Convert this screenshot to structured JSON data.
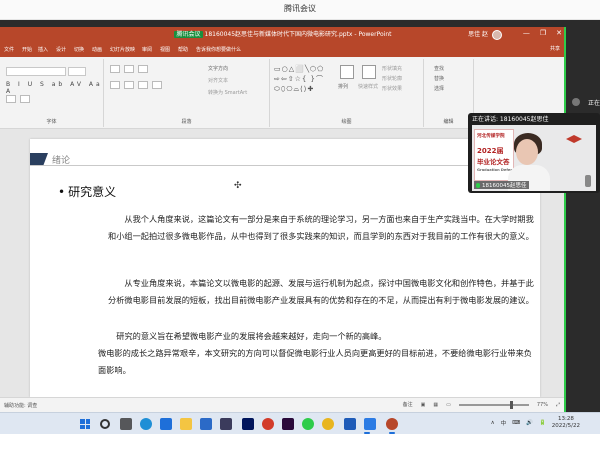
{
  "meeting": {
    "app_title": "腾讯会议"
  },
  "ppt": {
    "window_title": "18160045赵思佳与新媒体时代下国内微电影研究.pptx - PowerPoint",
    "screen_tag": "腾讯会议",
    "user_name": "思佳 赵",
    "window_controls": {
      "minimize": "—",
      "restore": "❐",
      "close": "✕"
    },
    "tabs": [
      "文件",
      "开始",
      "插入",
      "设计",
      "切换",
      "动画",
      "幻灯片放映",
      "审阅",
      "视图",
      "帮助",
      "告诉我你想要做什么"
    ],
    "share_label": "共享",
    "ribbon": {
      "groups": [
        "字体",
        "段落",
        "绘图",
        "编辑"
      ],
      "paragraph_items": [
        "文字方向",
        "对齐文本",
        "转换为 SmartArt"
      ],
      "drawing_items": [
        "排列",
        "快速样式",
        "形状填充",
        "形状轮廓",
        "形状效果"
      ],
      "editing_items": [
        "查找",
        "替换",
        "选择"
      ],
      "font_format": "B I U S ab AV Aa A"
    },
    "slide": {
      "section_title": "绪论",
      "heading": "研究意义",
      "bullet": "•",
      "paragraphs": [
        "从我个人角度来说，这篇论文有一部分是来自于系统的理论学习，另一方面也来自于生产实践当中。在大学时期我和小组一起拍过很多微电影作品，从中也得到了很多实践来的知识，而且学到的东西对于我目前的工作有很大的意义。",
        "从专业角度来说，本篇论文以微电影的起源、发展与运行机制为起点，探讨中国微电影文化和创作特色，并基于此分析微电影目前发展的短板，找出目前微电影产业发展具有的优势和存在的不足，从而提出有利于微电影发展的建议。",
        "研究的意义旨在希望微电影产业的发展将会越来越好，走向一个新的高峰。",
        "微电影的成长之路异常艰辛，本文研究的方向可以督促微电影行业人员向更高更好的目标前进，不要给微电影行业带来负面影响。"
      ],
      "cursor_glyph": "✣"
    },
    "status": {
      "left": "辅助功能: 调查",
      "notes": "备注",
      "zoom": "77%",
      "zoom_fraction": 0.77
    }
  },
  "speaker_panel": {
    "speaking_label": "正在讲话: 18160045赵思佳",
    "name_tag": "18160045赵思佳",
    "top_label": "正在",
    "poster_lines": [
      "河北传媒学院",
      "2022届",
      "毕业论文答",
      "Graduation Defense"
    ]
  },
  "taskbar": {
    "tray": [
      "∧",
      "中",
      "⌨",
      "🔊",
      "🔋"
    ],
    "time": "13:28",
    "date": "2022/5/22",
    "colors": {
      "accent": "#1e6fd9",
      "ppt": "#b7472a",
      "green": "#2ecc4a"
    }
  }
}
